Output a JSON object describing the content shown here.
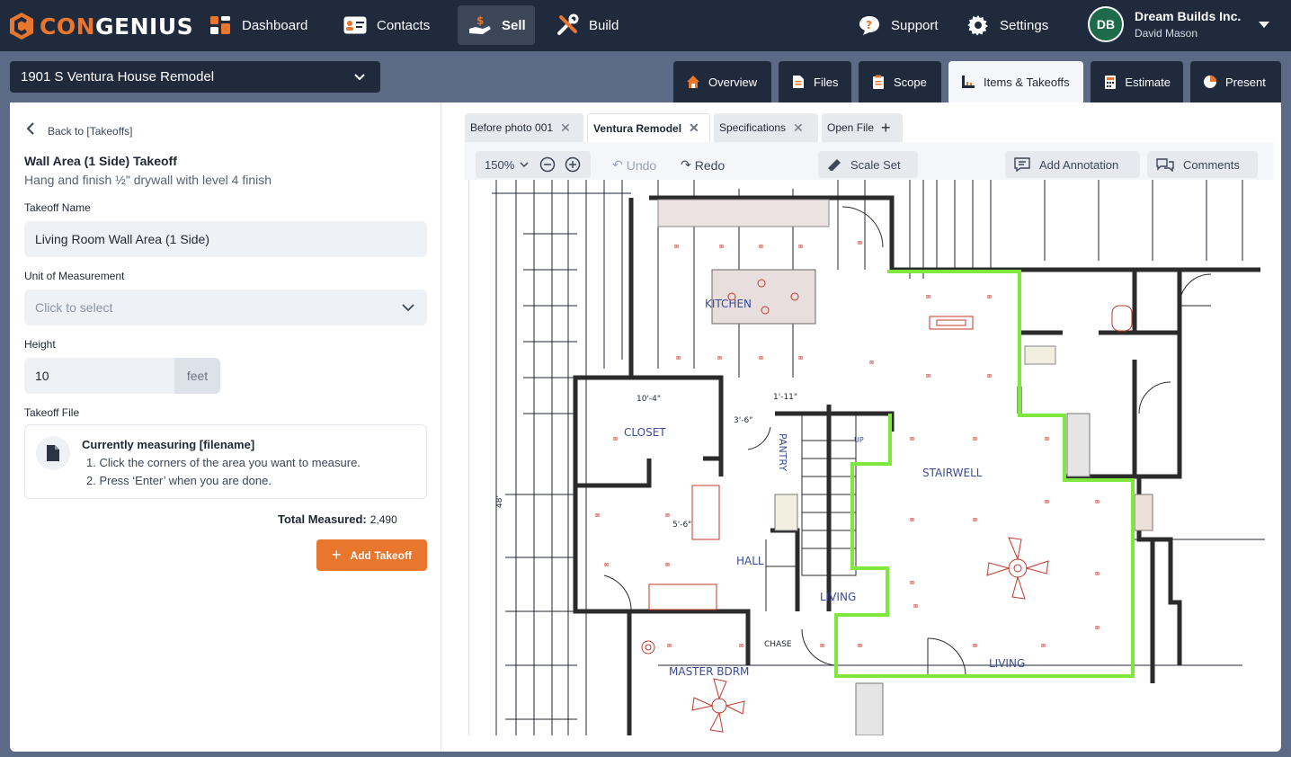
{
  "app": {
    "brand_part1": "CON",
    "brand_part2": "GENIUS"
  },
  "nav": {
    "dashboard": "Dashboard",
    "contacts": "Contacts",
    "sell": "Sell",
    "build": "Build",
    "support": "Support",
    "settings": "Settings"
  },
  "account": {
    "company": "Dream Builds Inc.",
    "user": "David Mason",
    "avatar_text": "DB"
  },
  "project": {
    "name": "1901 S Ventura House Remodel"
  },
  "tabs": [
    "Overview",
    "Files",
    "Scope",
    "Items & Takeoffs",
    "Estimate",
    "Present"
  ],
  "panel": {
    "back": "Back to [Takeoffs]",
    "title": "Wall Area (1 Side) Takeoff",
    "subtitle": "Hang and finish ½\" drywall with level 4 finish",
    "name_label": "Takeoff Name",
    "name_value": "Living Room Wall Area (1 Side)",
    "unit_label": "Unit of Measurement",
    "unit_placeholder": "Click to select",
    "height_label": "Height",
    "height_value": "10",
    "height_unit": "feet",
    "file_label": "Takeoff File",
    "file_heading": "Currently measuring [filename]",
    "step1": "1. Click the corners of the area you want to measure.",
    "step2": "2. Press ‘Enter’ when you are done.",
    "total_label": "Total Measured:",
    "total_value": "2,490",
    "add_button": "Add Takeoff"
  },
  "file_tabs": [
    "Before photo 001",
    "Ventura Remodel",
    "Specifications",
    "Open File"
  ],
  "toolbar": {
    "zoom": "150%",
    "undo": "Undo",
    "redo": "Redo",
    "scale": "Scale Set",
    "annotation": "Add Annotation",
    "comments": "Comments"
  },
  "plan_labels": {
    "kitchen": "KITCHEN",
    "closet": "CLOSET",
    "pantry": "PANTRY",
    "stairwell": "STAIRWELL",
    "hall": "HALL",
    "living1": "LIVING",
    "living2": "LIVING",
    "master": "MASTER BDRM",
    "chase": "CHASE",
    "up": "UP",
    "d1": "10'-4\"",
    "d2": "3'-6\"",
    "d3": "1'-11\"",
    "d4": "5'-6\"",
    "d5": "48'"
  },
  "colors": {
    "accent": "#e8762d",
    "navy": "#1f2a3d",
    "highlight": "#7ee83f",
    "fixture": "#c0392b"
  }
}
